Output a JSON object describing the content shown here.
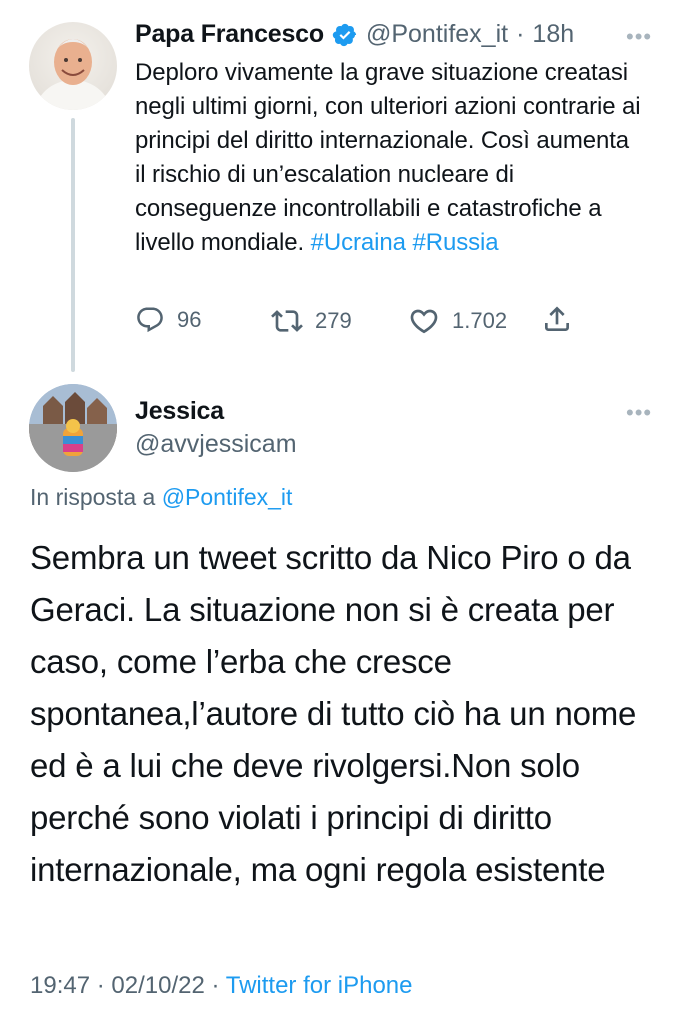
{
  "parent_tweet": {
    "author_name": "Papa Francesco",
    "verified_icon": "verified-badge-icon",
    "handle": "@Pontifex_it",
    "separator": "·",
    "time": "18h",
    "more": "•••",
    "text": "Deploro vivamente la grave situazione creatasi negli ultimi giorni, con ulteriori azioni contrarie ai principi del diritto internazionale. Così aumenta il rischio di un’escalation nucleare di conseguenze incontrollabili e catastrofiche a livello mondiale.",
    "hashtags": [
      "#Ucraina",
      "#Russia"
    ],
    "stats": {
      "replies": "96",
      "retweets": "279",
      "likes": "1.702"
    }
  },
  "reply_tweet": {
    "author_name": "Jessica",
    "handle": "@avvjessicam",
    "more": "•••",
    "in_reply_label": "In risposta a",
    "in_reply_mention": "@Pontifex_it",
    "text": "Sembra un tweet scritto da Nico Piro o da Geraci. La situazione non si è creata per caso, come l’erba che cresce spontanea,l’autore di tutto ciò ha un nome ed è a lui che deve rivolgersi.Non solo perché sono violati i principi di diritto internazionale, ma ogni regola esistente",
    "time": "19:47",
    "date": "02/10/22",
    "separator": "·",
    "source": "Twitter for iPhone"
  },
  "colors": {
    "text": "#0f1419",
    "muted": "#536471",
    "accent": "#1d9bf0",
    "thread_line": "#cfd9de"
  }
}
